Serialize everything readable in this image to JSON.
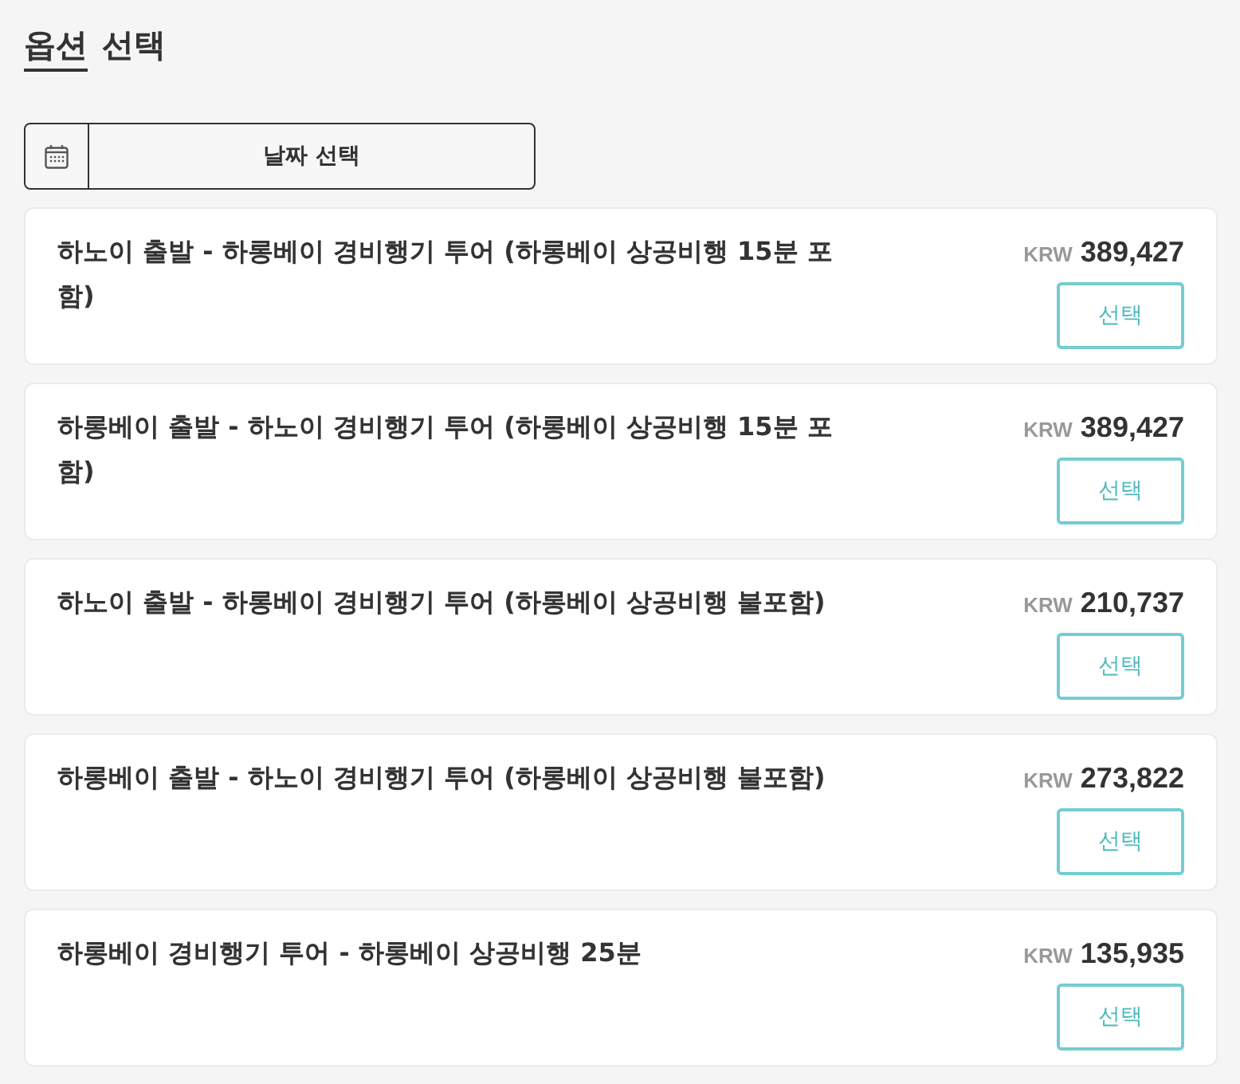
{
  "heading": {
    "words": [
      {
        "text": "옵션",
        "underlined": true
      },
      {
        "text": "선택",
        "underlined": false
      }
    ]
  },
  "date_picker": {
    "label": "날짜 선택"
  },
  "options": [
    {
      "title": "하노이 출발 - 하롱베이 경비행기 투어 (하롱베이 상공비행 15분 포함)",
      "currency": "KRW",
      "price": "389,427",
      "button": "선택"
    },
    {
      "title": "하롱베이 출발 - 하노이 경비행기 투어 (하롱베이 상공비행 15분 포함)",
      "currency": "KRW",
      "price": "389,427",
      "button": "선택"
    },
    {
      "title": "하노이 출발 - 하롱베이 경비행기 투어 (하롱베이 상공비행 불포함)",
      "currency": "KRW",
      "price": "210,737",
      "button": "선택"
    },
    {
      "title": "하롱베이 출발 - 하노이 경비행기 투어 (하롱베이 상공비행 불포함)",
      "currency": "KRW",
      "price": "273,822",
      "button": "선택"
    },
    {
      "title": "하롱베이 경비행기 투어 - 하롱베이 상공비행 25분",
      "currency": "KRW",
      "price": "135,935",
      "button": "선택"
    }
  ]
}
